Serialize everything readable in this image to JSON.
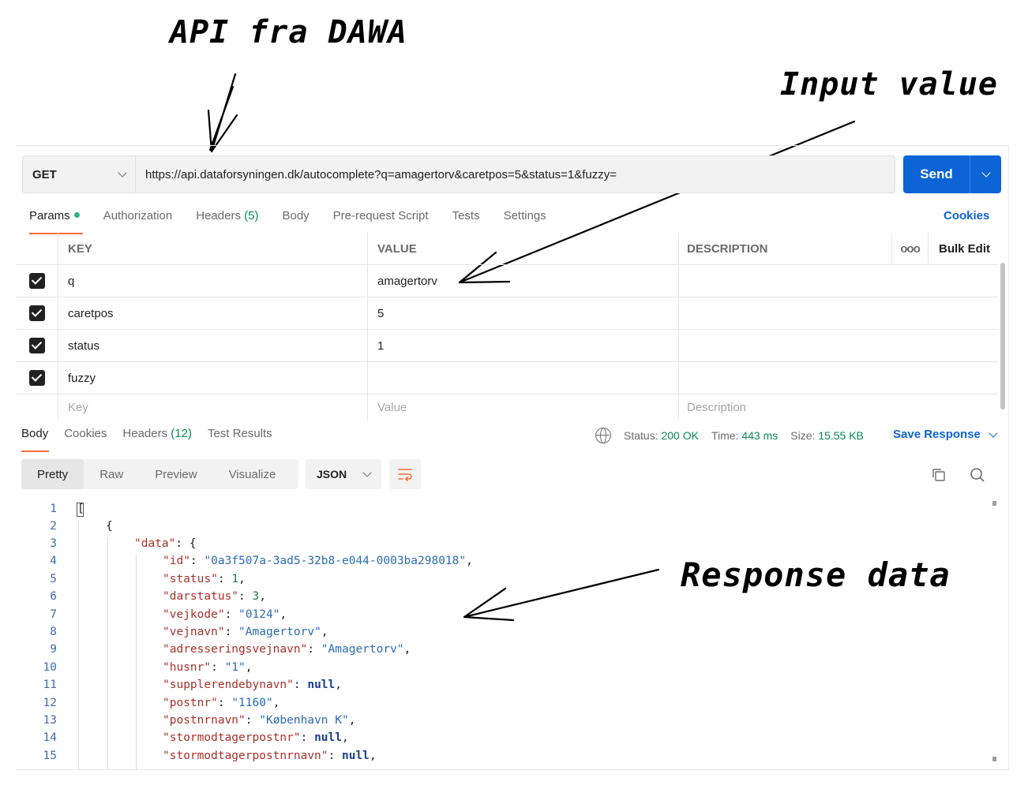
{
  "annotations": {
    "api": "API fra DAWA",
    "input": "Input value",
    "response": "Response data"
  },
  "request": {
    "method": "GET",
    "url": "https://api.dataforsyningen.dk/autocomplete?q=amagertorv&caretpos=5&status=1&fuzzy=",
    "send_label": "Send"
  },
  "request_tabs": {
    "params": "Params",
    "authorization": "Authorization",
    "headers": "Headers",
    "headers_count": "(5)",
    "body": "Body",
    "prerequest": "Pre-request Script",
    "tests": "Tests",
    "settings": "Settings",
    "cookies": "Cookies"
  },
  "params": {
    "columns": {
      "key": "KEY",
      "value": "VALUE",
      "description": "DESCRIPTION",
      "more": "ooo",
      "bulk_edit": "Bulk Edit"
    },
    "rows": [
      {
        "key": "q",
        "value": "amagertorv",
        "description": ""
      },
      {
        "key": "caretpos",
        "value": "5",
        "description": ""
      },
      {
        "key": "status",
        "value": "1",
        "description": ""
      },
      {
        "key": "fuzzy",
        "value": "",
        "description": ""
      }
    ],
    "placeholders": {
      "key": "Key",
      "value": "Value",
      "description": "Description"
    }
  },
  "response_tabs": {
    "body": "Body",
    "cookies": "Cookies",
    "headers": "Headers",
    "headers_count": "(12)",
    "test_results": "Test Results"
  },
  "status": {
    "status_label": "Status:",
    "status_value": "200 OK",
    "time_label": "Time:",
    "time_value": "443 ms",
    "size_label": "Size:",
    "size_value": "15.55 KB",
    "save_response": "Save Response"
  },
  "viewer": {
    "modes": [
      "Pretty",
      "Raw",
      "Preview",
      "Visualize"
    ],
    "format": "JSON"
  },
  "code_lines": [
    "1",
    "2",
    "3",
    "4",
    "5",
    "6",
    "7",
    "8",
    "9",
    "10",
    "11",
    "12",
    "13",
    "14",
    "15"
  ],
  "colors": {
    "accent": "#ff6c37",
    "send": "#0c64d6",
    "link": "#0c64d6",
    "status_green": "#0a8a54",
    "json_key": "#a9302a",
    "json_string": "#2b6cb5"
  }
}
